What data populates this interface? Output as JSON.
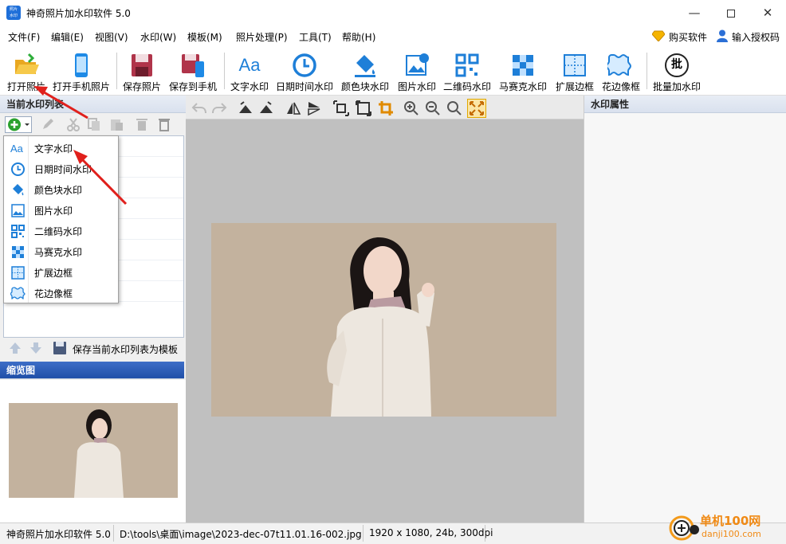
{
  "window": {
    "title": "神奇照片加水印软件 5.0",
    "app_icon_text_1": "照片",
    "app_icon_text_2": "水印"
  },
  "menu": [
    "文件(F)",
    "编辑(E)",
    "视图(V)",
    "水印(W)",
    "模板(M)",
    "照片处理(P)",
    "工具(T)",
    "帮助(H)"
  ],
  "menu_right": {
    "buy": "购买软件",
    "license": "输入授权码"
  },
  "toolbar": [
    {
      "label": "打开照片",
      "icon": "open-folder-icon"
    },
    {
      "label": "打开手机照片",
      "icon": "phone-icon"
    },
    {
      "label": "保存照片",
      "icon": "save-icon"
    },
    {
      "label": "保存到手机",
      "icon": "save-to-phone-icon"
    },
    {
      "label": "文字水印",
      "icon": "text-icon"
    },
    {
      "label": "日期时间水印",
      "icon": "clock-icon"
    },
    {
      "label": "颜色块水印",
      "icon": "paint-bucket-icon"
    },
    {
      "label": "图片水印",
      "icon": "image-icon"
    },
    {
      "label": "二维码水印",
      "icon": "qrcode-icon"
    },
    {
      "label": "马赛克水印",
      "icon": "mosaic-icon"
    },
    {
      "label": "扩展边框",
      "icon": "extend-border-icon"
    },
    {
      "label": "花边像框",
      "icon": "lace-frame-icon"
    },
    {
      "label": "批量加水印",
      "icon": "batch-icon"
    }
  ],
  "toolbar_batch_glyph": "批",
  "text_icon_glyph": "Aa",
  "left_panel": {
    "list_title": "当前水印列表",
    "save_template": "保存当前水印列表为模板",
    "preview_title": "缩览图"
  },
  "right_panel": {
    "title": "水印属性"
  },
  "dropdown": [
    {
      "label": "文字水印",
      "icon": "text-icon"
    },
    {
      "label": "日期时间水印",
      "icon": "clock-icon"
    },
    {
      "label": "颜色块水印",
      "icon": "paint-bucket-icon"
    },
    {
      "label": "图片水印",
      "icon": "image-icon"
    },
    {
      "label": "二维码水印",
      "icon": "qrcode-icon"
    },
    {
      "label": "马赛克水印",
      "icon": "mosaic-icon"
    },
    {
      "label": "扩展边框",
      "icon": "extend-border-icon"
    },
    {
      "label": "花边像框",
      "icon": "lace-frame-icon"
    }
  ],
  "status": {
    "app": "神奇照片加水印软件 5.0",
    "path": "D:\\tools\\桌面\\image\\2023-dec-07t11.01.16-002.jpg",
    "info": "1920 x 1080, 24b, 300dpi"
  },
  "watermark": {
    "cn": "单机100网",
    "en": "danji100.com"
  },
  "colors": {
    "accent": "#1e6fd9",
    "photo_bg": "#c3b29e",
    "arrow": "#e0201c"
  }
}
